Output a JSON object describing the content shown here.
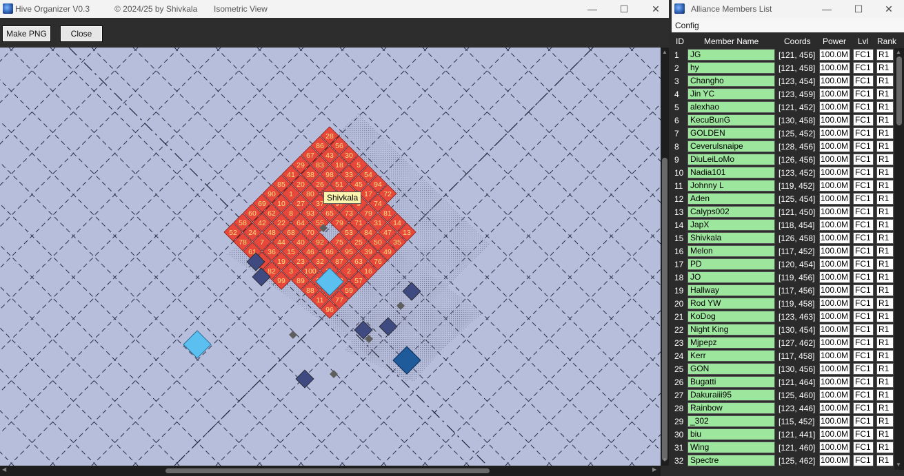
{
  "main_window": {
    "title": "Hive Organizer V0.3",
    "copyright": "© 2024/25 by Shivkala",
    "view": "Isometric View",
    "controls": {
      "minimize": "—",
      "maximize": "☐",
      "close": "✕"
    }
  },
  "toolbar": {
    "make_png": "Make PNG",
    "close": "Close"
  },
  "map": {
    "background": "#b6bedc",
    "colors": {
      "member": "#e8483c",
      "member_text": "#f4e27a",
      "hq": "#5bc0f0",
      "obstacle": "#3e4a80",
      "fortress": "#1f5a9a",
      "gray_marker": "#5e5e5e"
    },
    "tooltip": "Shivkala",
    "tiles": [
      {
        "n": "65"
      },
      {
        "n": "55"
      },
      {
        "n": "70"
      },
      {
        "n": "79"
      },
      {
        "n": "92"
      },
      {
        "n": "53"
      },
      {
        "n": "75"
      },
      {
        "n": "66"
      },
      {
        "n": "89"
      },
      {
        "n": "37"
      },
      {
        "n": "93"
      },
      {
        "n": "64"
      },
      {
        "n": "68"
      },
      {
        "n": "97"
      },
      {
        "n": "40"
      },
      {
        "n": "73"
      },
      {
        "n": "46"
      },
      {
        "n": "71"
      },
      {
        "n": "32"
      },
      {
        "n": "84"
      },
      {
        "n": "25"
      },
      {
        "n": "95"
      },
      {
        "n": "87"
      },
      {
        "n": "21"
      },
      {
        "n": "98"
      },
      {
        "n": "26"
      },
      {
        "n": "80"
      },
      {
        "n": "27"
      },
      {
        "n": "8"
      },
      {
        "n": "22"
      },
      {
        "n": "48"
      },
      {
        "n": "51"
      },
      {
        "n": "44"
      },
      {
        "n": "4"
      },
      {
        "n": "15"
      },
      {
        "n": "9"
      },
      {
        "n": "23"
      },
      {
        "n": "79"
      },
      {
        "n": "100"
      },
      {
        "n": "31"
      },
      {
        "n": "34"
      },
      {
        "n": "47"
      },
      {
        "n": "50"
      },
      {
        "n": "39"
      },
      {
        "n": "63"
      },
      {
        "n": "2"
      },
      {
        "n": "12"
      },
      {
        "n": "91"
      },
      {
        "n": "43"
      },
      {
        "n": "83"
      },
      {
        "n": "38"
      },
      {
        "n": "20"
      },
      {
        "n": "1"
      },
      {
        "n": "10"
      },
      {
        "n": "62"
      },
      {
        "n": "42"
      },
      {
        "n": "24"
      },
      {
        "n": "18"
      },
      {
        "n": "7"
      },
      {
        "n": "33"
      },
      {
        "n": "36"
      },
      {
        "n": "45"
      },
      {
        "n": "19"
      },
      {
        "n": "17"
      },
      {
        "n": "3"
      },
      {
        "n": "74"
      },
      {
        "n": "89"
      },
      {
        "n": "81"
      },
      {
        "n": "88"
      },
      {
        "n": "14"
      },
      {
        "n": "11"
      },
      {
        "n": "13"
      },
      {
        "n": "35"
      },
      {
        "n": "49"
      },
      {
        "n": "76"
      },
      {
        "n": "16"
      },
      {
        "n": "57"
      },
      {
        "n": "59"
      },
      {
        "n": "77"
      },
      {
        "n": "96"
      },
      {
        "n": "28"
      },
      {
        "n": "86"
      },
      {
        "n": "67"
      },
      {
        "n": "29"
      },
      {
        "n": "41"
      },
      {
        "n": "85"
      },
      {
        "n": "90"
      },
      {
        "n": "69"
      },
      {
        "n": "60"
      },
      {
        "n": "58"
      },
      {
        "n": "52"
      },
      {
        "n": "56"
      },
      {
        "n": "78"
      },
      {
        "n": "30"
      },
      {
        "n": "61"
      },
      {
        "n": "5"
      },
      {
        "n": "6"
      },
      {
        "n": "54"
      },
      {
        "n": "82"
      },
      {
        "n": "94"
      },
      {
        "n": "99"
      },
      {
        "n": "72"
      }
    ]
  },
  "members_window": {
    "title": "Alliance Members List",
    "menu": "Config",
    "columns": {
      "id": "ID",
      "name": "Member Name",
      "coords": "Coords",
      "power": "Power",
      "lvl": "Lvl",
      "rank": "Rank"
    },
    "name_color": "#9de69d",
    "members": [
      {
        "id": "1",
        "name": "JG",
        "coords": "[121, 456]",
        "power": "100.0M",
        "lvl": "FC1",
        "rank": "R1"
      },
      {
        "id": "2",
        "name": "hy",
        "coords": "[121, 458]",
        "power": "100.0M",
        "lvl": "FC1",
        "rank": "R1"
      },
      {
        "id": "3",
        "name": "Changho",
        "coords": "[123, 454]",
        "power": "100.0M",
        "lvl": "FC1",
        "rank": "R1"
      },
      {
        "id": "4",
        "name": "Jin YC",
        "coords": "[123, 459]",
        "power": "100.0M",
        "lvl": "FC1",
        "rank": "R1"
      },
      {
        "id": "5",
        "name": "alexhao",
        "coords": "[121, 452]",
        "power": "100.0M",
        "lvl": "FC1",
        "rank": "R1"
      },
      {
        "id": "6",
        "name": "KecuBunG",
        "coords": "[130, 458]",
        "power": "100.0M",
        "lvl": "FC1",
        "rank": "R1"
      },
      {
        "id": "7",
        "name": "GOLDEN",
        "coords": "[125, 452]",
        "power": "100.0M",
        "lvl": "FC1",
        "rank": "R1"
      },
      {
        "id": "8",
        "name": "Ceverulsnaipe",
        "coords": "[128, 456]",
        "power": "100.0M",
        "lvl": "FC1",
        "rank": "R1"
      },
      {
        "id": "9",
        "name": "DiuLeiLoMo",
        "coords": "[126, 456]",
        "power": "100.0M",
        "lvl": "FC1",
        "rank": "R1"
      },
      {
        "id": "10",
        "name": "Nadia101",
        "coords": "[123, 452]",
        "power": "100.0M",
        "lvl": "FC1",
        "rank": "R1"
      },
      {
        "id": "11",
        "name": "Johnny L",
        "coords": "[119, 452]",
        "power": "100.0M",
        "lvl": "FC1",
        "rank": "R1"
      },
      {
        "id": "12",
        "name": "Aden",
        "coords": "[125, 454]",
        "power": "100.0M",
        "lvl": "FC1",
        "rank": "R1"
      },
      {
        "id": "13",
        "name": "Calyps002",
        "coords": "[121, 450]",
        "power": "100.0M",
        "lvl": "FC1",
        "rank": "R1"
      },
      {
        "id": "14",
        "name": "JapX",
        "coords": "[118, 454]",
        "power": "100.0M",
        "lvl": "FC1",
        "rank": "R1"
      },
      {
        "id": "15",
        "name": "Shivkala",
        "coords": "[126, 458]",
        "power": "100.0M",
        "lvl": "FC1",
        "rank": "R1"
      },
      {
        "id": "16",
        "name": "Melon",
        "coords": "[117, 452]",
        "power": "100.0M",
        "lvl": "FC1",
        "rank": "R1"
      },
      {
        "id": "17",
        "name": "PD",
        "coords": "[120, 454]",
        "power": "100.0M",
        "lvl": "FC1",
        "rank": "R1"
      },
      {
        "id": "18",
        "name": "JO",
        "coords": "[119, 456]",
        "power": "100.0M",
        "lvl": "FC1",
        "rank": "R1"
      },
      {
        "id": "19",
        "name": "Hallway",
        "coords": "[117, 456]",
        "power": "100.0M",
        "lvl": "FC1",
        "rank": "R1"
      },
      {
        "id": "20",
        "name": "Rod YW",
        "coords": "[119, 458]",
        "power": "100.0M",
        "lvl": "FC1",
        "rank": "R1"
      },
      {
        "id": "21",
        "name": "KoDog",
        "coords": "[123, 463]",
        "power": "100.0M",
        "lvl": "FC1",
        "rank": "R1"
      },
      {
        "id": "22",
        "name": "Night King",
        "coords": "[130, 454]",
        "power": "100.0M",
        "lvl": "FC1",
        "rank": "R1"
      },
      {
        "id": "23",
        "name": "Mjpepz",
        "coords": "[127, 462]",
        "power": "100.0M",
        "lvl": "FC1",
        "rank": "R1"
      },
      {
        "id": "24",
        "name": "Kerr",
        "coords": "[117, 458]",
        "power": "100.0M",
        "lvl": "FC1",
        "rank": "R1"
      },
      {
        "id": "25",
        "name": "GON",
        "coords": "[130, 456]",
        "power": "100.0M",
        "lvl": "FC1",
        "rank": "R1"
      },
      {
        "id": "26",
        "name": "Bugatti",
        "coords": "[121, 464]",
        "power": "100.0M",
        "lvl": "FC1",
        "rank": "R1"
      },
      {
        "id": "27",
        "name": "Dakuraiii95",
        "coords": "[125, 460]",
        "power": "100.0M",
        "lvl": "FC1",
        "rank": "R1"
      },
      {
        "id": "28",
        "name": "Rainbow",
        "coords": "[123, 446]",
        "power": "100.0M",
        "lvl": "FC1",
        "rank": "R1"
      },
      {
        "id": "29",
        "name": "_302",
        "coords": "[115, 452]",
        "power": "100.0M",
        "lvl": "FC1",
        "rank": "R1"
      },
      {
        "id": "30",
        "name": "biu",
        "coords": "[121, 441]",
        "power": "100.0M",
        "lvl": "FC1",
        "rank": "R1"
      },
      {
        "id": "31",
        "name": "Wing",
        "coords": "[121, 460]",
        "power": "100.0M",
        "lvl": "FC1",
        "rank": "R1"
      },
      {
        "id": "32",
        "name": "Spectre",
        "coords": "[125, 462]",
        "power": "100.0M",
        "lvl": "FC1",
        "rank": "R1"
      }
    ]
  }
}
